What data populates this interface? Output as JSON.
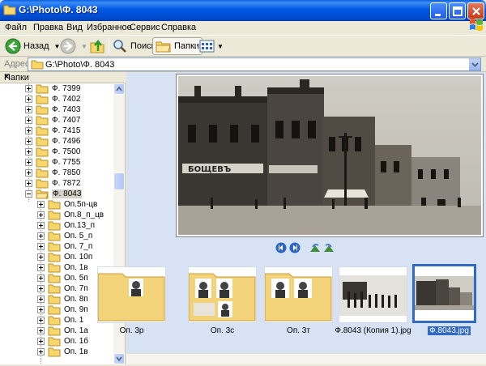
{
  "window": {
    "title": "G:\\Photo\\Ф. 8043"
  },
  "menu": [
    "Файл",
    "Правка",
    "Вид",
    "Избранное",
    "Сервис",
    "Справка"
  ],
  "toolbar": {
    "back": "Назад",
    "search": "Поиск",
    "folders": "Папки"
  },
  "address": {
    "label": "Адрес",
    "path": "G:\\Photo\\Ф. 8043"
  },
  "folders_pane": {
    "title": "Папки",
    "close": "×",
    "items": [
      "Ф. 7399",
      "Ф. 7402",
      "Ф. 7403",
      "Ф. 7407",
      "Ф. 7415",
      "Ф. 7496",
      "Ф. 7500",
      "Ф. 7755",
      "Ф. 7850",
      "Ф. 7872",
      "Ф. 8043"
    ],
    "subitems": [
      "Оп.5п-цв",
      "Оп.8_п_цв",
      "Оп.13_п",
      "Оп. 5_п",
      "Оп. 7_п",
      "Оп. 10п",
      "Оп. 1в",
      "Оп. 5п",
      "Оп. 7п",
      "Оп. 8п",
      "Оп. 9п",
      "Оп. 1",
      "Оп. 1а",
      "Оп. 1б",
      "Оп. 1в"
    ]
  },
  "preview": {
    "sign_text": "БОЩЕВЪ"
  },
  "thumbnails": [
    {
      "caption": "Оп. 3р"
    },
    {
      "caption": "Оп. 3с"
    },
    {
      "caption": "Оп. 3т"
    },
    {
      "caption": "Ф.8043 (Копия 1).jpg"
    },
    {
      "caption": "Ф.8043.jpg"
    }
  ],
  "colors": {
    "selection": "#316ac5",
    "content_bg": "#d8e2f5",
    "titlebar": "#0058e6"
  }
}
